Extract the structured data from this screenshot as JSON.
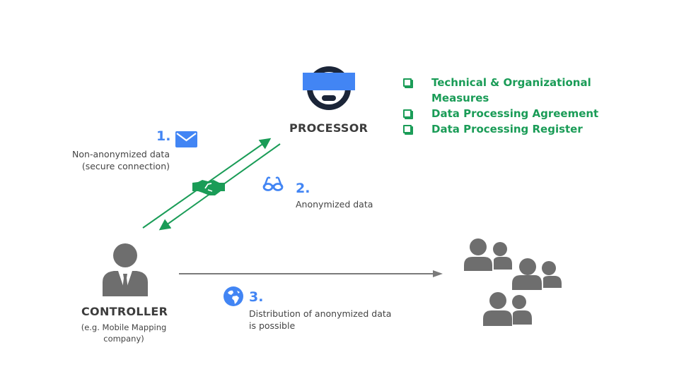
{
  "processor": {
    "title": "PROCESSOR",
    "icon": "masked-face-icon"
  },
  "checklist": {
    "color": "#1a9c57",
    "items": [
      {
        "label": "Technical & Organizational",
        "label2": "Measures"
      },
      {
        "label": "Data Processing Agreement"
      },
      {
        "label": "Data Processing Register"
      }
    ]
  },
  "step1": {
    "number": "1.",
    "icon": "envelope-icon",
    "line1": "Non-anonymized data",
    "line2": "(secure connection)"
  },
  "step2": {
    "number": "2.",
    "icon": "glasses-icon",
    "line1": "Anonymized data"
  },
  "step3": {
    "number": "3.",
    "icon": "globe-icon",
    "line1": "Distribution of anonymized data",
    "line2": "is possible"
  },
  "controller": {
    "title": "CONTROLLER",
    "line1": "(e.g. Mobile Mapping",
    "line2": "company)",
    "icon": "businessman-icon"
  },
  "recipients": {
    "icon": "user-groups-icon"
  },
  "colors": {
    "accent_blue": "#4285f4",
    "green": "#1a9c57",
    "gray_icon": "#6e6e6e",
    "navy": "#1b2538"
  }
}
